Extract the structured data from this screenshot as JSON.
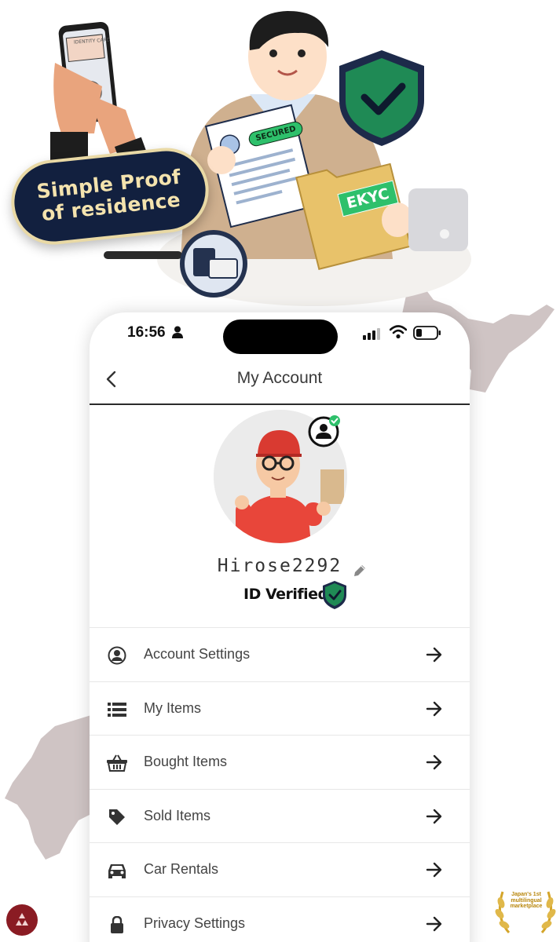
{
  "hero": {
    "badge_line1": "Simple Proof",
    "badge_line2": "of residence",
    "doc_stamp": "SECURED",
    "folder_label": "EKYC",
    "id_card_text": "IDENTITY CARD"
  },
  "status_bar": {
    "time": "16:56"
  },
  "header": {
    "title": "My Account"
  },
  "profile": {
    "username": "Hirose2292",
    "verification_status": "ID Verified"
  },
  "menu": {
    "items": [
      {
        "label": "Account Settings",
        "icon": "account-circle-icon"
      },
      {
        "label": "My Items",
        "icon": "list-icon"
      },
      {
        "label": "Bought Items",
        "icon": "basket-icon"
      },
      {
        "label": "Sold Items",
        "icon": "tag-icon"
      },
      {
        "label": "Car Rentals",
        "icon": "car-icon"
      },
      {
        "label": "Privacy Settings",
        "icon": "lock-icon"
      }
    ]
  },
  "footer": {
    "laurel_text": "Japan's 1st multilingual marketplace"
  },
  "colors": {
    "accent_green": "#2ec06b",
    "badge_navy": "#12203f",
    "badge_gold": "#f4e3ae",
    "map_gray": "#cfc4c4",
    "brand_maroon": "#8a1b23"
  }
}
